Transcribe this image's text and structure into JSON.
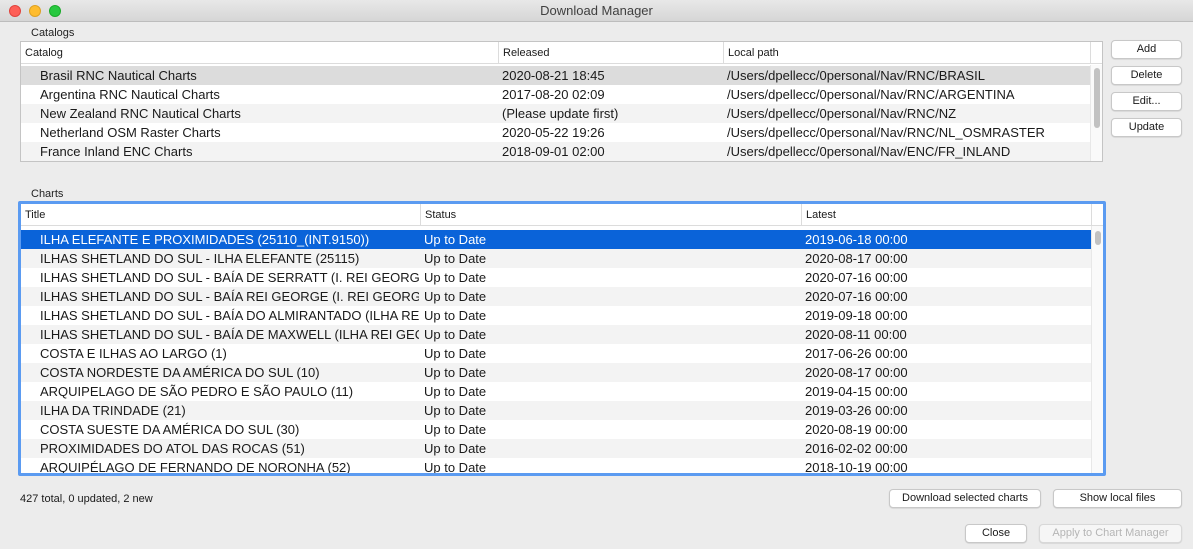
{
  "window": {
    "title": "Download Manager"
  },
  "catalogs": {
    "section_label": "Catalogs",
    "columns": [
      "Catalog",
      "Released",
      "Local path"
    ],
    "rows": [
      {
        "catalog": "Brasil RNC Nautical Charts",
        "released": "2020-08-21 18:45",
        "path": "/Users/dpellecc/0personal/Nav/RNC/BRASIL"
      },
      {
        "catalog": "Argentina RNC Nautical Charts",
        "released": "2017-08-20 02:09",
        "path": "/Users/dpellecc/0personal/Nav/RNC/ARGENTINA"
      },
      {
        "catalog": "New Zealand RNC Nautical Charts",
        "released": "(Please update first)",
        "path": "/Users/dpellecc/0personal/Nav/RNC/NZ"
      },
      {
        "catalog": "Netherland OSM Raster Charts",
        "released": "2020-05-22 19:26",
        "path": "/Users/dpellecc/0personal/Nav/RNC/NL_OSMRASTER"
      },
      {
        "catalog": "France Inland ENC Charts",
        "released": "2018-09-01 02:00",
        "path": "/Users/dpellecc/0personal/Nav/ENC/FR_INLAND"
      }
    ],
    "buttons": {
      "add": "Add",
      "delete": "Delete",
      "edit": "Edit...",
      "update": "Update"
    }
  },
  "charts": {
    "section_label": "Charts",
    "columns": [
      "Title",
      "Status",
      "Latest"
    ],
    "rows": [
      {
        "title": "ILHA ELEFANTE E PROXIMIDADES (25110_(INT.9150))",
        "status": "Up to Date",
        "latest": "2019-06-18 00:00"
      },
      {
        "title": "ILHAS SHETLAND DO SUL - ILHA ELEFANTE (25115)",
        "status": "Up to Date",
        "latest": "2020-08-17 00:00"
      },
      {
        "title": "ILHAS SHETLAND DO SUL - BAÍA DE SERRATT (I. REI GEORGE",
        "status": "Up to Date",
        "latest": "2020-07-16 00:00"
      },
      {
        "title": "ILHAS SHETLAND DO SUL - BAÍA REI GEORGE (I. REI GEORGE",
        "status": "Up to Date",
        "latest": "2020-07-16 00:00"
      },
      {
        "title": "ILHAS SHETLAND DO SUL - BAÍA DO ALMIRANTADO (ILHA RE",
        "status": "Up to Date",
        "latest": "2019-09-18 00:00"
      },
      {
        "title": "ILHAS SHETLAND DO SUL - BAÍA DE MAXWELL (ILHA REI GEC",
        "status": "Up to Date",
        "latest": "2020-08-11 00:00"
      },
      {
        "title": "COSTA E ILHAS AO LARGO (1)",
        "status": "Up to Date",
        "latest": "2017-06-26 00:00"
      },
      {
        "title": "COSTA NORDESTE DA AMÉRICA DO SUL (10)",
        "status": "Up to Date",
        "latest": "2020-08-17 00:00"
      },
      {
        "title": "ARQUIPELAGO DE SÃO PEDRO E SÃO PAULO (11)",
        "status": "Up to Date",
        "latest": "2019-04-15 00:00"
      },
      {
        "title": "ILHA DA TRINDADE (21)",
        "status": "Up to Date",
        "latest": "2019-03-26 00:00"
      },
      {
        "title": "COSTA SUESTE DA AMÉRICA DO SUL (30)",
        "status": "Up to Date",
        "latest": "2020-08-19 00:00"
      },
      {
        "title": "PROXIMIDADES DO ATOL DAS ROCAS (51)",
        "status": "Up to Date",
        "latest": "2016-02-02 00:00"
      },
      {
        "title": "ARQUIPÉLAGO DE FERNANDO DE NORONHA (52)",
        "status": "Up to Date",
        "latest": "2018-10-19 00:00"
      }
    ]
  },
  "status_text": "427 total, 0 updated, 2 new",
  "buttons": {
    "download_selected": "Download selected charts",
    "show_local": "Show local files",
    "close": "Close",
    "apply": "Apply to Chart Manager"
  }
}
